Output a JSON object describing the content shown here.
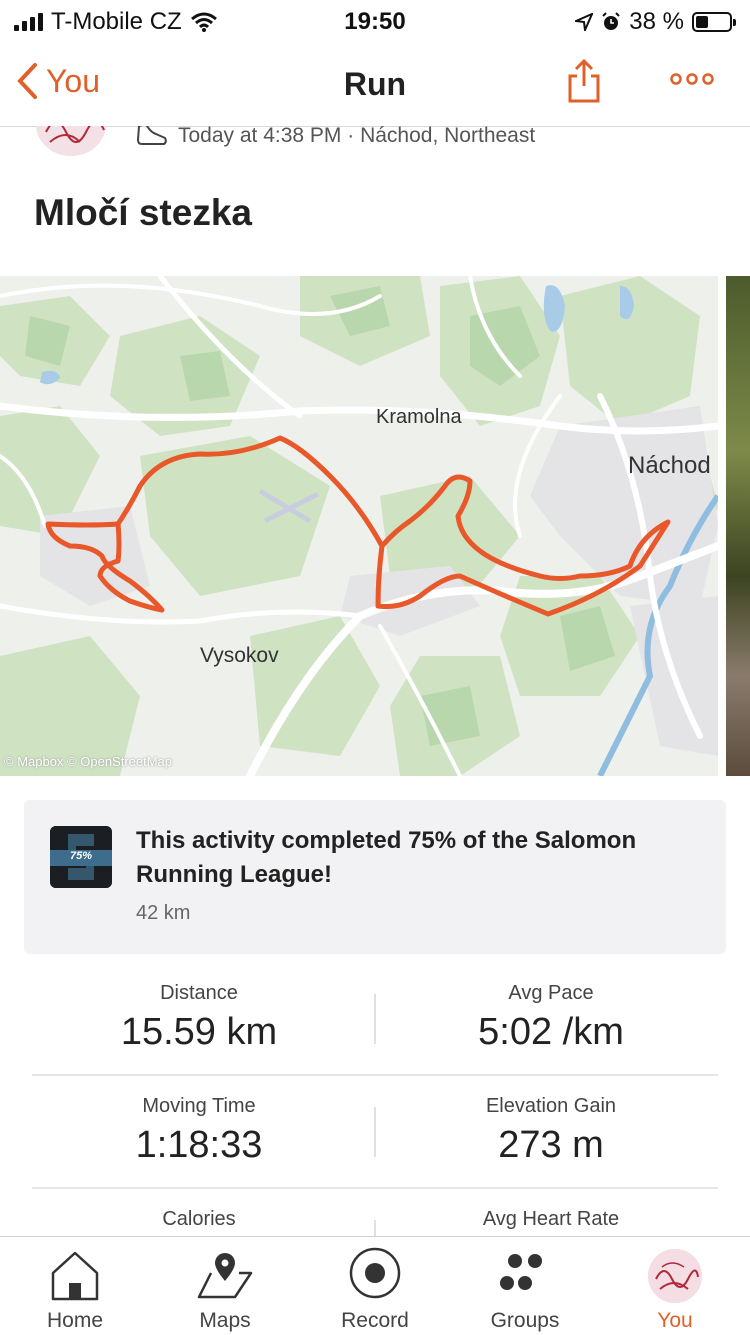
{
  "status_bar": {
    "carrier": "T-Mobile CZ",
    "time": "19:50",
    "battery": "38 %",
    "battery_level": 0.38
  },
  "nav": {
    "back_label": "You",
    "title": "Run"
  },
  "activity": {
    "meta": "Today at 4:38 PM · Náchod, Northeast",
    "title": "Mločí stezka"
  },
  "map": {
    "labels": {
      "kramolna": "Kramolna",
      "nachod": "Náchod",
      "vysokov": "Vysokov"
    },
    "attribution": "© Mapbox © OpenStreetMap",
    "route_color": "#e8582a"
  },
  "achievement": {
    "badge_text": "75%",
    "text": "This activity completed 75% of the Salomon Running League!",
    "sub": "42 km"
  },
  "stats": {
    "distance_label": "Distance",
    "distance_value": "15.59 km",
    "pace_label": "Avg Pace",
    "pace_value": "5:02 /km",
    "moving_label": "Moving Time",
    "moving_value": "1:18:33",
    "elev_label": "Elevation Gain",
    "elev_value": "273 m",
    "calories_label": "Calories",
    "hr_label": "Avg Heart Rate"
  },
  "tabs": {
    "home": "Home",
    "maps": "Maps",
    "record": "Record",
    "groups": "Groups",
    "you": "You"
  },
  "colors": {
    "accent": "#e0602a"
  }
}
